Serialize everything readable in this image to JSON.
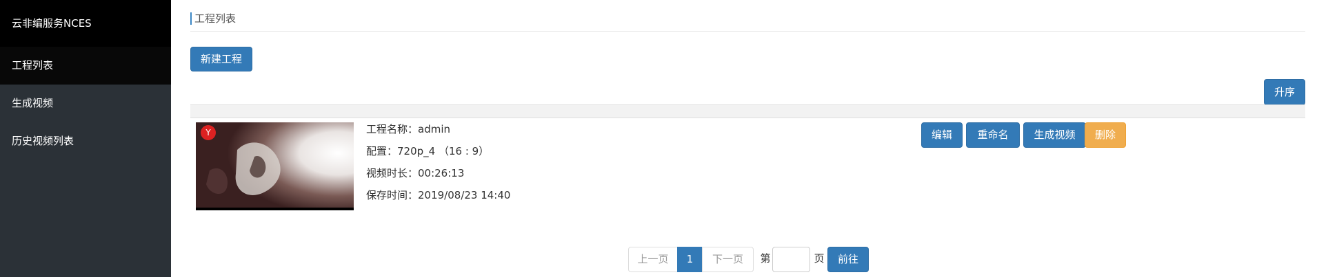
{
  "sidebar": {
    "brand": "云非编服务NCES",
    "items": [
      {
        "label": "工程列表",
        "active": true
      },
      {
        "label": "生成视频",
        "active": false
      },
      {
        "label": "历史视频列表",
        "active": false
      }
    ]
  },
  "header": {
    "title": "工程列表"
  },
  "toolbar": {
    "new_project_label": "新建工程",
    "sort_label": "升序"
  },
  "project": {
    "name_line": "工程名称：admin",
    "config_line": "配置：720p_4 （16 : 9）",
    "duration_line": "视频时长：00:26:13",
    "saved_line": "保存时间：2019/08/23 14:40",
    "actions": {
      "edit": "编辑",
      "rename": "重命名",
      "generate": "生成视频",
      "delete": "删除"
    }
  },
  "pagination": {
    "prev": "上一页",
    "current": "1",
    "next": "下一页",
    "page_prefix": "第",
    "page_input_value": "",
    "page_suffix": "页",
    "go": "前往"
  },
  "colors": {
    "primary": "#337ab7",
    "warning": "#f0ad4e",
    "sidebar_bg": "#2b3137",
    "brand_bg": "#000000"
  }
}
